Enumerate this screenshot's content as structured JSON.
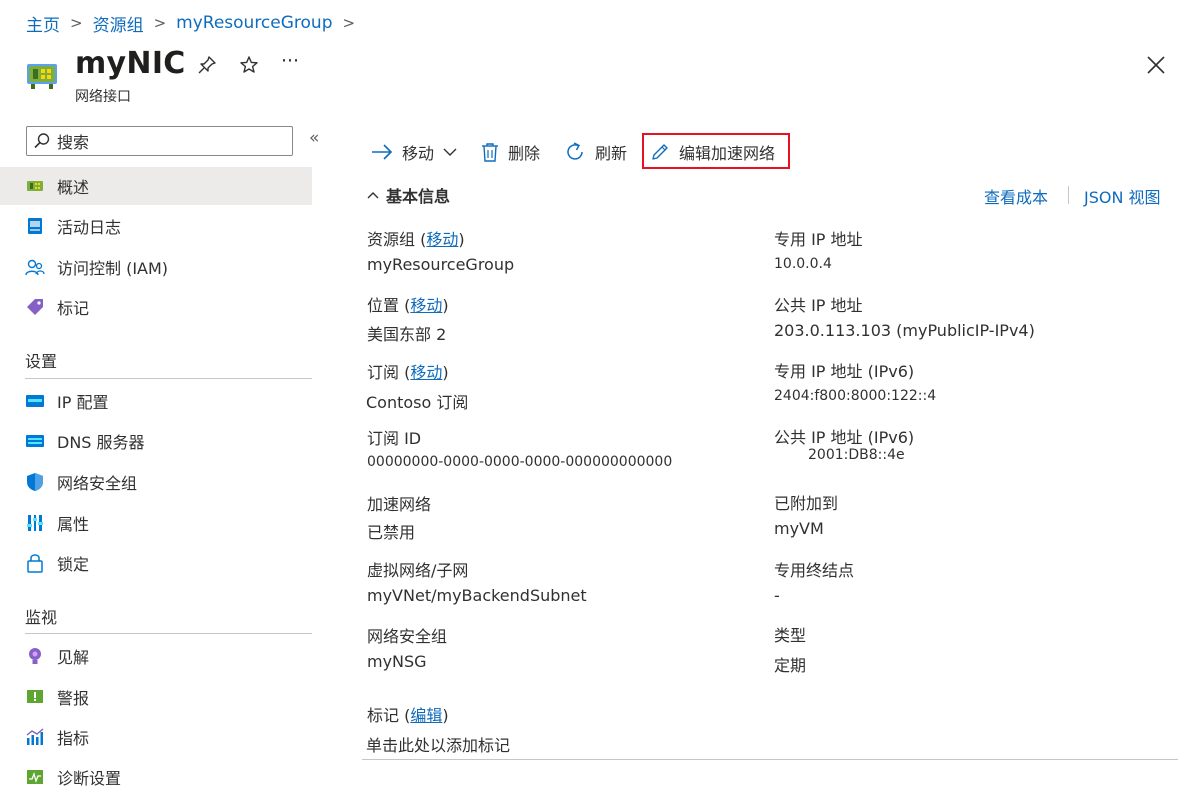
{
  "breadcrumb": [
    "主页",
    "资源组",
    "myResourceGroup"
  ],
  "header": {
    "title": "myNIC",
    "subtitle": "网络接口",
    "more": "···"
  },
  "sidebar": {
    "search_placeholder": "搜索",
    "collapse": "«",
    "items_top": [
      {
        "label": "概述",
        "icon": "nic-icon"
      },
      {
        "label": "活动日志",
        "icon": "activity-log-icon"
      },
      {
        "label": "访问控制 (IAM)",
        "icon": "iam-icon"
      },
      {
        "label": "标记",
        "icon": "tag-icon"
      }
    ],
    "section_settings": "设置",
    "items_settings": [
      {
        "label": "IP 配置",
        "icon": "ip-config-icon"
      },
      {
        "label": "DNS 服务器",
        "icon": "dns-icon"
      },
      {
        "label": "网络安全组",
        "icon": "shield-icon"
      },
      {
        "label": "属性",
        "icon": "properties-icon"
      },
      {
        "label": "锁定",
        "icon": "lock-icon"
      }
    ],
    "section_monitoring": "监视",
    "items_monitoring": [
      {
        "label": "见解",
        "icon": "insights-icon"
      },
      {
        "label": "警报",
        "icon": "alert-icon"
      },
      {
        "label": "指标",
        "icon": "metrics-icon"
      },
      {
        "label": "诊断设置",
        "icon": "diagnostics-icon"
      }
    ]
  },
  "toolbar": {
    "move": "移动",
    "delete": "删除",
    "refresh": "刷新",
    "edit_accel": "编辑加速网络"
  },
  "essentials": {
    "toggle": "基本信息",
    "view_cost": "查看成本",
    "json_view": "JSON 视图",
    "left": {
      "rg_label": "资源组",
      "rg_move": "移动",
      "rg_value": "myResourceGroup",
      "loc_label": "位置",
      "loc_move": "移动",
      "loc_value": "美国东部 2",
      "sub_label": "订阅",
      "sub_move": "移动",
      "sub_value": "Contoso 订阅",
      "subid_label": "订阅 ID",
      "subid_value": "00000000-0000-0000-0000-000000000000",
      "accel_label": "加速网络",
      "accel_value": "已禁用",
      "vnet_label": "虚拟网络/子网",
      "vnet_value": "myVNet/myBackendSubnet",
      "nsg_label": "网络安全组",
      "nsg_value": "myNSG"
    },
    "right": {
      "privip_label": "专用 IP 地址",
      "privip_value": "10.0.0.4",
      "pubip_label": "公共 IP 地址",
      "pubip_value": "203.0.113.103 (myPublicIP-IPv4)",
      "privip6_label": "专用 IP 地址 (IPv6)",
      "privip6_value": "2404:f800:8000:122::4",
      "pubip6_label": "公共 IP 地址 (IPv6)",
      "pubip6_value": "2001:DB8::4e",
      "attached_label": "已附加到",
      "attached_value": "myVM",
      "pe_label": "专用终结点",
      "pe_value": "-",
      "type_label": "类型",
      "type_value": "定期"
    },
    "tags_label": "标记",
    "tags_edit": "编辑",
    "tags_add": "单击此处以添加标记"
  }
}
